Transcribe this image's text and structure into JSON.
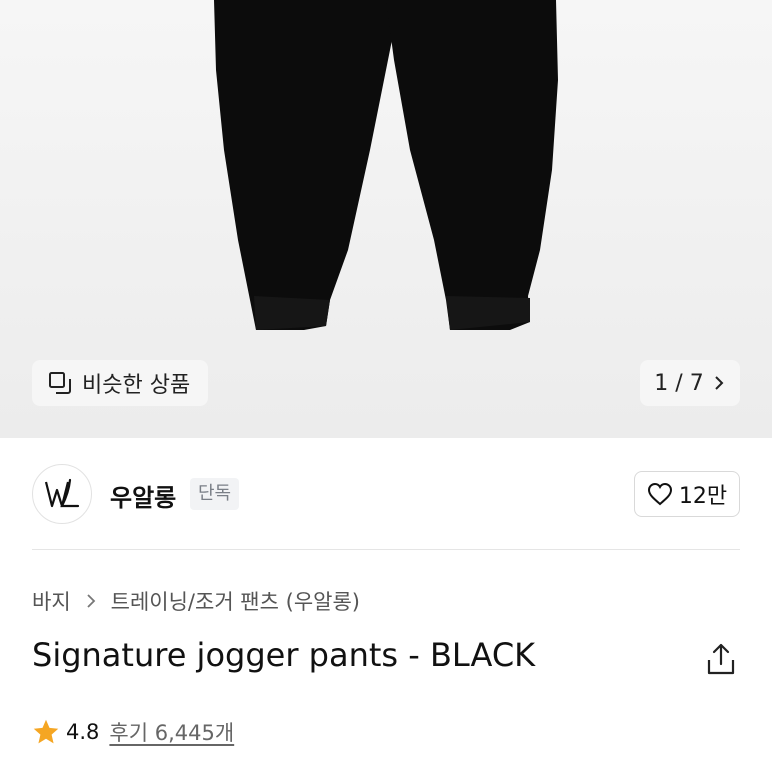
{
  "gallery": {
    "similar_label": "비슷한 상품",
    "pager": "1 / 7",
    "current_index": 1,
    "total_images": 7
  },
  "brand": {
    "name": "우알롱",
    "logo_text": "WL",
    "exclusive_badge": "단독",
    "like_count": "12만"
  },
  "breadcrumb": {
    "items": [
      "바지",
      "트레이닝/조거 팬츠 (우알롱)"
    ]
  },
  "product": {
    "title": "Signature jogger pants - BLACK"
  },
  "rating": {
    "score": "4.8",
    "reviews": "후기 6,445개"
  },
  "icons": {
    "similar": "overlap-squares-icon",
    "pager_next": "chevron-right-icon",
    "like": "heart-icon",
    "share": "share-icon",
    "star": "star-icon",
    "breadcrumb_sep": "chevron-right-icon"
  },
  "colors": {
    "star": "#f5a623",
    "badge_bg": "#f2f3f5",
    "badge_text": "#7a7f87"
  }
}
